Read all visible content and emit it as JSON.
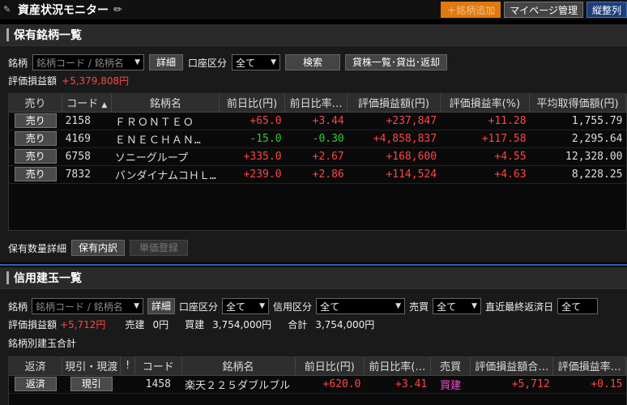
{
  "app": {
    "title": "資産状況モニター",
    "btn_add": "＋銘柄追加",
    "btn_mypage": "マイページ管理",
    "btn_layout": "縦整列"
  },
  "holdings": {
    "title": "保有銘柄一覧",
    "meigara_label": "銘柄",
    "meigara_placeholder": "銘柄コード / 銘柄名",
    "detail_btn": "詳細",
    "account_label": "口座区分",
    "account_value": "全て",
    "search_btn": "検索",
    "lending_btn": "貸株一覧･貸出･返却",
    "pl_label": "評価損益額",
    "pl_value": "+5,379,808円",
    "columns": [
      "売り",
      "コード",
      "銘柄名",
      "前日比(円)",
      "前日比率…",
      "評価損益額(円)",
      "評価損益率(%)",
      "平均取得価額(円)"
    ],
    "rows": [
      {
        "sell": "売り",
        "code": "2158",
        "name": "ＦＲＯＮＴＥＯ",
        "change": "+65.0",
        "change_rate": "+3.44",
        "pl": "+237,847",
        "pl_rate": "+11.28",
        "avg": "1,755.79",
        "dir": "up"
      },
      {
        "sell": "売り",
        "code": "4169",
        "name": "ＥＮＥＣＨＡＮ…",
        "change": "-15.0",
        "change_rate": "-0.30",
        "pl": "+4,858,837",
        "pl_rate": "+117.58",
        "avg": "2,295.64",
        "dir": "down"
      },
      {
        "sell": "売り",
        "code": "6758",
        "name": "ソニーグループ",
        "change": "+335.0",
        "change_rate": "+2.67",
        "pl": "+168,600",
        "pl_rate": "+4.55",
        "avg": "12,328.00",
        "dir": "up"
      },
      {
        "sell": "売り",
        "code": "7832",
        "name": "バンダイナムコＨＬ…",
        "change": "+239.0",
        "change_rate": "+2.86",
        "pl": "+114,524",
        "pl_rate": "+4.63",
        "avg": "8,228.25",
        "dir": "up"
      }
    ],
    "qty_detail_label": "保有数量詳細",
    "breakdown_btn": "保有内訳",
    "price_register_btn": "単価登録"
  },
  "margin": {
    "title": "信用建玉一覧",
    "meigara_label": "銘柄",
    "meigara_placeholder": "銘柄コード / 銘柄名",
    "detail_btn": "詳細",
    "account_label": "口座区分",
    "account_value": "全て",
    "credit_label": "信用区分",
    "credit_value": "全て",
    "side_label": "売買",
    "side_value": "全て",
    "due_label": "直近最終返済日",
    "due_value": "全て",
    "pl_label": "評価損益額",
    "pl_value": "+5,712円",
    "short_label": "売建",
    "short_value": "0円",
    "long_label": "買建",
    "long_value": "3,754,000円",
    "total_label": "合計",
    "total_value": "3,754,000円",
    "summary_label": "銘柄別建玉合計",
    "columns": [
      "返済",
      "現引・現渡",
      "!",
      "コード",
      "銘柄名",
      "前日比(円)",
      "前日比率(…",
      "売買",
      "評価損益額合…",
      "評価損益率…"
    ],
    "rows": [
      {
        "repay": "返済",
        "delivery": "現引",
        "code": "1458",
        "name": "楽天２２５ダブルブル",
        "change": "+620.0",
        "change_rate": "+3.41",
        "side": "買建",
        "pl": "+5,712",
        "pl_rate": "+0.15"
      }
    ]
  }
}
